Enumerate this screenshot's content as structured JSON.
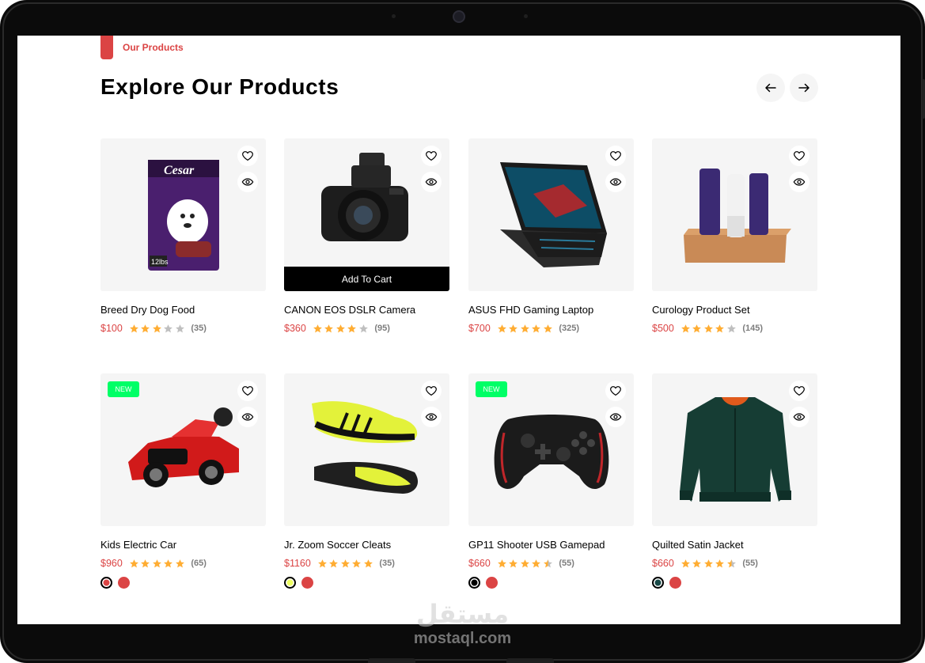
{
  "section": {
    "tag": "Our Products",
    "title": "Explore Our Products",
    "prev_icon": "arrow-left-icon",
    "next_icon": "arrow-right-icon"
  },
  "colors": {
    "accent": "#db4444",
    "new_badge": "#00ff66",
    "star": "#ffad33",
    "star_empty": "#bfbfbf",
    "card_bg": "#f5f5f5"
  },
  "products": [
    {
      "name": "Breed Dry Dog Food",
      "price": "$100",
      "rating": 3,
      "reviews": "(35)",
      "badge": "",
      "add_to_cart": ""
    },
    {
      "name": "CANON EOS DSLR Camera",
      "price": "$360",
      "rating": 4,
      "reviews": "(95)",
      "badge": "",
      "add_to_cart": "Add To Cart"
    },
    {
      "name": "ASUS FHD Gaming Laptop",
      "price": "$700",
      "rating": 5,
      "reviews": "(325)",
      "badge": "",
      "add_to_cart": ""
    },
    {
      "name": "Curology Product Set",
      "price": "$500",
      "rating": 4,
      "reviews": "(145)",
      "badge": "",
      "add_to_cart": ""
    },
    {
      "name": "Kids Electric Car",
      "price": "$960",
      "rating": 5,
      "reviews": "(65)",
      "badge": "NEW",
      "add_to_cart": "",
      "swatches": [
        "#db4444",
        "#db4444"
      ]
    },
    {
      "name": "Jr. Zoom Soccer Cleats",
      "price": "$1160",
      "rating": 5,
      "reviews": "(35)",
      "badge": "",
      "add_to_cart": "",
      "swatches": [
        "#eeff61",
        "#db4444"
      ]
    },
    {
      "name": "GP11 Shooter USB Gamepad",
      "price": "$660",
      "rating": 4.5,
      "reviews": "(55)",
      "badge": "NEW",
      "add_to_cart": "",
      "swatches": [
        "#000000",
        "#db4444"
      ]
    },
    {
      "name": "Quilted Satin Jacket",
      "price": "$660",
      "rating": 4.5,
      "reviews": "(55)",
      "badge": "",
      "add_to_cart": "",
      "swatches": [
        "#184a48",
        "#db4444"
      ]
    }
  ],
  "watermark": {
    "arabic": "مستقل",
    "latin": "mostaql.com"
  }
}
